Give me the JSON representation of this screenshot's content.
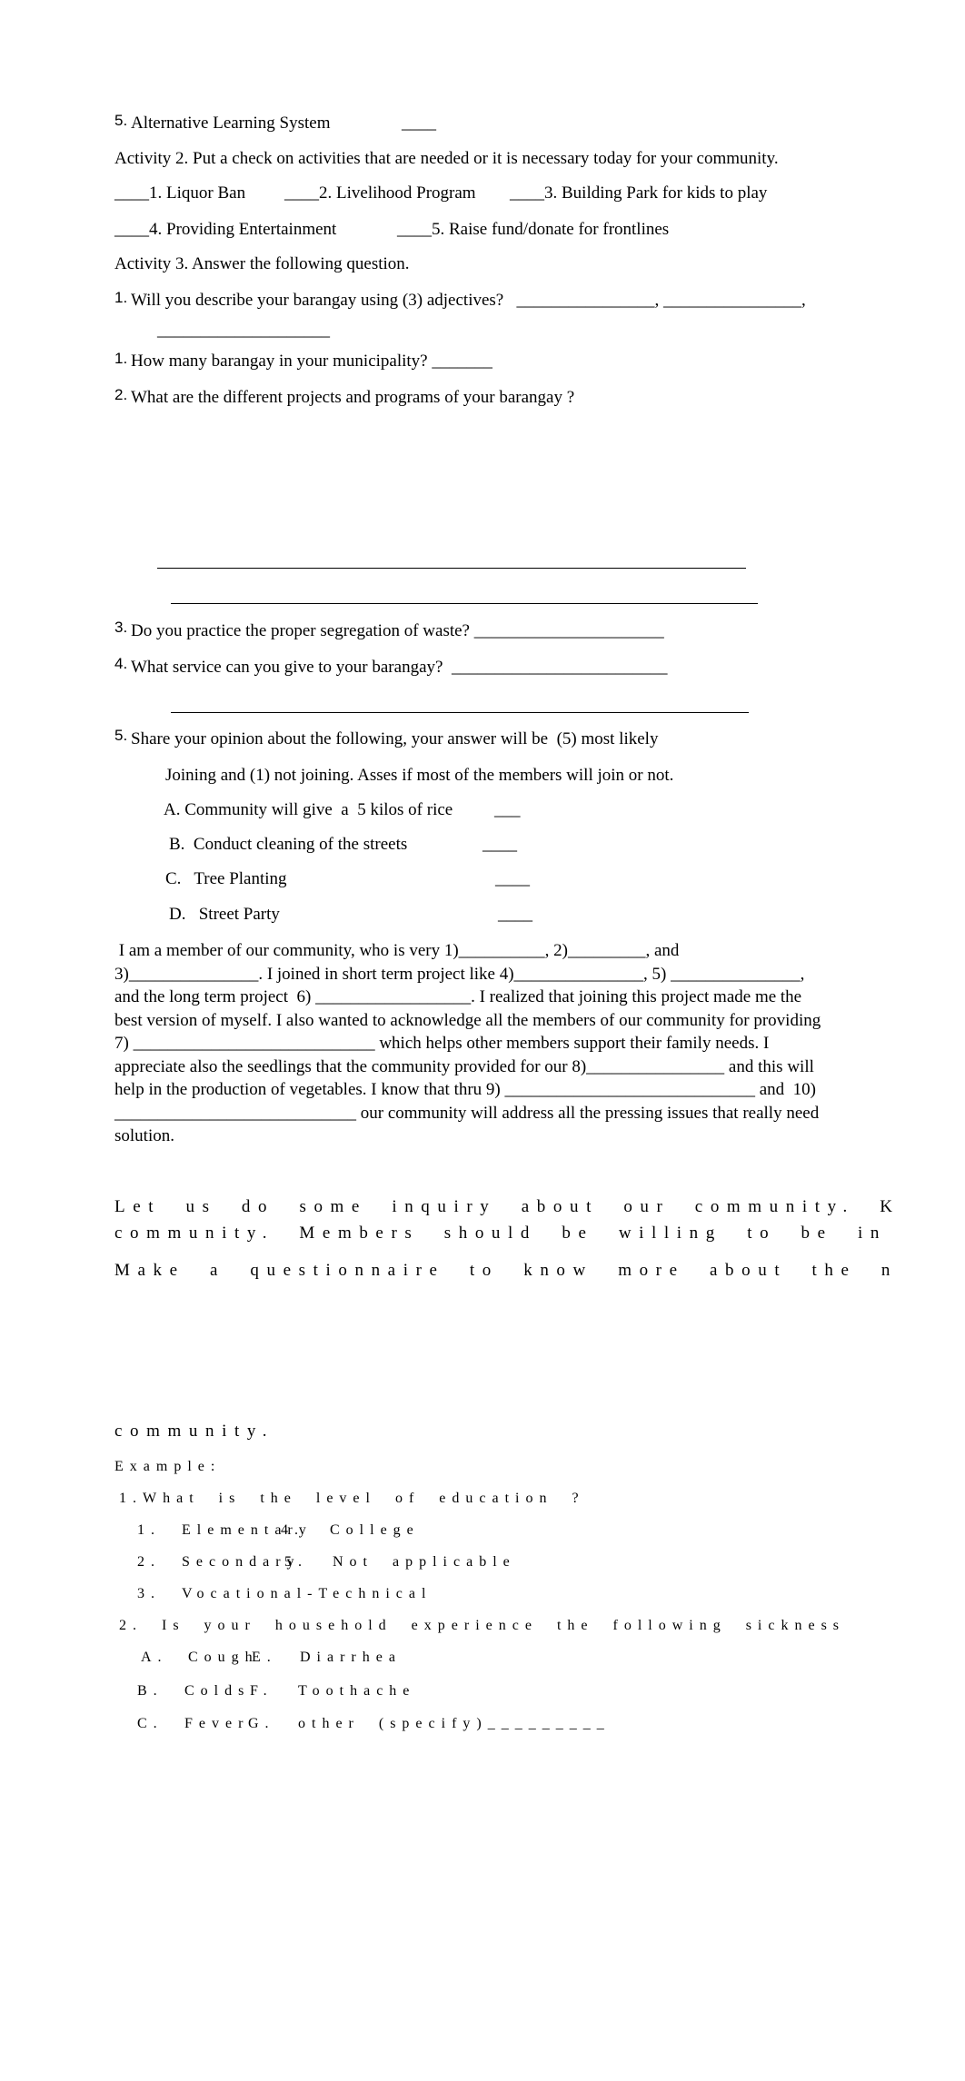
{
  "activity1_tail": {
    "item5_num": "5.",
    "item5_text": "Alternative Learning System",
    "item5_blank": "____"
  },
  "activity2": {
    "heading": "Activity 2. Put a check on activities that are needed or it is necessary today for your community.",
    "items": [
      "____1. Liquor Ban",
      "____2. Livelihood Program",
      "____3. Building Park for kids to play",
      "____4. Providing Entertainment",
      "____5. Raise fund/donate for frontlines"
    ]
  },
  "activity3": {
    "heading": "Activity 3. Answer the following question.",
    "q1_num": "1.",
    "q1_text": "Will you describe your barangay using (3) adjectives?   ________________, ________________,",
    "q1_cont": "____________________",
    "q2_num": "1.",
    "q2_text": "How many barangay in your municipality? _______",
    "q3_num": "2.",
    "q3_text": "What are the different projects and programs of your barangay ?",
    "q4_num": "3.",
    "q4_text": "Do you practice the proper segregation of waste? ______________________",
    "q5_num": "4.",
    "q5_text": "What service can you give to your barangay?  _________________________",
    "q6_num": "5.",
    "q6_text": "Share your opinion about the following, your answer will be  (5) most likely",
    "q6_cont": "Joining and (1) not joining. Asses if most of the members will join or not.",
    "options": [
      {
        "text": "A. Community will give  a  5 kilos of rice",
        "blank": "___"
      },
      {
        "text": "B.  Conduct cleaning of the streets",
        "blank": "____"
      },
      {
        "text": "C.   Tree Planting",
        "blank": "____"
      },
      {
        "text": "D.   Street Party",
        "blank": "____"
      }
    ]
  },
  "paragraph": {
    "lines": [
      " I am a member of our community, who is very 1)__________, 2)_________, and",
      "3)_______________. I joined in short term project like 4)_______________, 5) _______________,",
      "and the long term project  6) __________________. I realized that joining this project made me the",
      "best version of myself. I also wanted to acknowledge all the members of our community for providing",
      "7) ____________________________ which helps other members support their family needs. I",
      "appreciate also the seedlings that the community provided for our 8)________________ and this will",
      "help in the production of vegetables. I know that thru 9) _____________________________ and  10)",
      "____________________________ our community will address all the pressing issues that really need",
      "solution."
    ]
  },
  "inquiry": {
    "line1": "Let us do some inquiry about our community. K",
    "line2": "community. Members should be willing to be in",
    "line3": "Make a questionnaire to know more about the n",
    "line4": "community.",
    "example_label": "Example:",
    "q1": "1.What is the level of education ?",
    "q1_options": [
      {
        "num": "1.",
        "left": "Elementary",
        "right_num": "4.",
        "right": "College"
      },
      {
        "num": "2.",
        "left": "Secondary",
        "right_num": "5.",
        "right": "Not applicable"
      },
      {
        "num": "3.",
        "left": "Vocational-Technical",
        "right_num": "",
        "right": ""
      }
    ],
    "q2": "2. Is your household experience the following sickness",
    "q2_options": [
      {
        "num": "A.",
        "left": "Cough",
        "right_num": "E.",
        "right": "Diarrhea"
      },
      {
        "num": "B.",
        "left": "Colds",
        "right_num": "F.",
        "right": "Toothache"
      },
      {
        "num": "C.",
        "left": "Fever",
        "right_num": "G.",
        "right": "other (specify)_________"
      }
    ]
  }
}
